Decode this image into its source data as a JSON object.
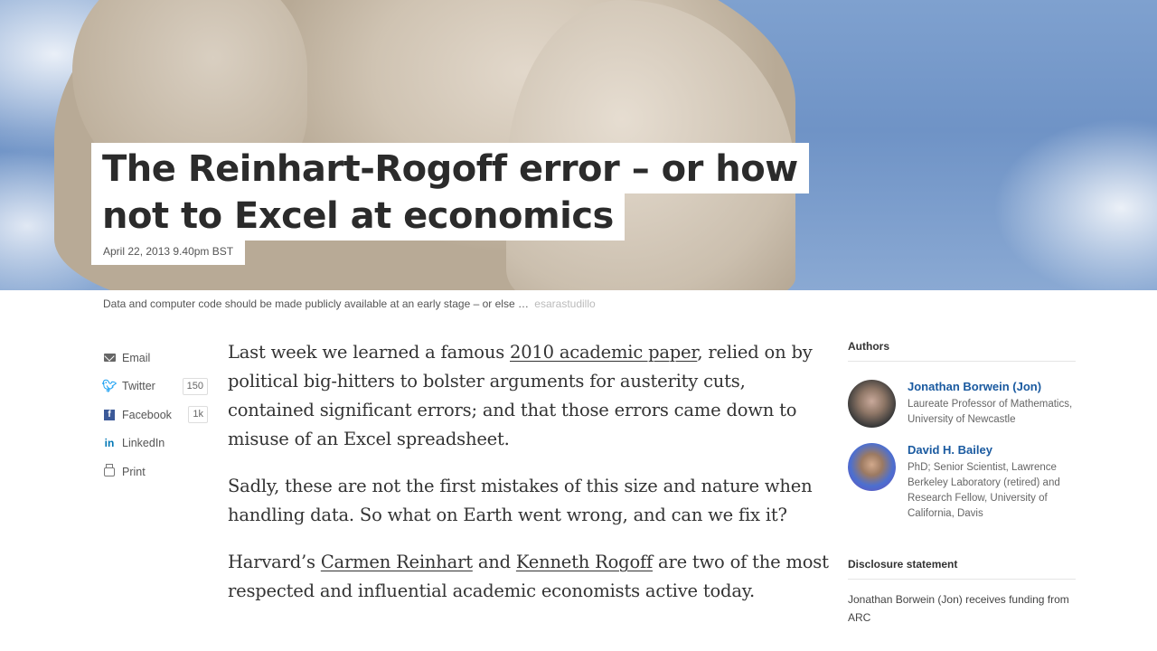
{
  "hero": {
    "title_line1": "The Reinhart-Rogoff error – or how",
    "title_line2": "not to Excel at economics",
    "date": "April 22, 2013 9.40pm BST",
    "caption": "Data and computer code should be made publicly available at an early stage – or else …",
    "credit": "esarastudillo"
  },
  "share": {
    "items": [
      {
        "label": "Email",
        "icon": "email-icon"
      },
      {
        "label": "Twitter",
        "icon": "twitter-icon",
        "count": "150"
      },
      {
        "label": "Facebook",
        "icon": "facebook-icon",
        "count": "1k"
      },
      {
        "label": "LinkedIn",
        "icon": "linkedin-icon"
      },
      {
        "label": "Print",
        "icon": "print-icon"
      }
    ]
  },
  "article": {
    "p1_before": "Last week we learned a famous ",
    "p1_link": "2010 academic paper",
    "p1_after": ", relied on by political big-hitters to bolster arguments for austerity cuts, contained significant errors; and that those errors came down to misuse of an Excel spreadsheet.",
    "p2": "Sadly, these are not the first mistakes of this size and nature when handling data. So what on Earth went wrong, and can we fix it?",
    "p3_before": "Harvard’s ",
    "p3_link1": "Carmen Reinhart",
    "p3_mid": " and ",
    "p3_link2": "Kenneth Rogoff",
    "p3_after": " are two of the most respected and influential academic economists active today."
  },
  "sidebar": {
    "authors_heading": "Authors",
    "authors": [
      {
        "name": "Jonathan Borwein (Jon)",
        "role": "Laureate Professor of Mathematics, University of Newcastle"
      },
      {
        "name": "David H. Bailey",
        "role": "PhD; Senior Scientist, Lawrence Berkeley Laboratory (retired) and Research Fellow, University of California, Davis"
      }
    ],
    "disclosure_heading": "Disclosure statement",
    "disclosure_text": "Jonathan Borwein (Jon) receives funding from ARC"
  },
  "colors": {
    "link_blue": "#1a5aa0",
    "twitter": "#1da1f2",
    "facebook": "#3b5998",
    "linkedin": "#0077b5"
  }
}
